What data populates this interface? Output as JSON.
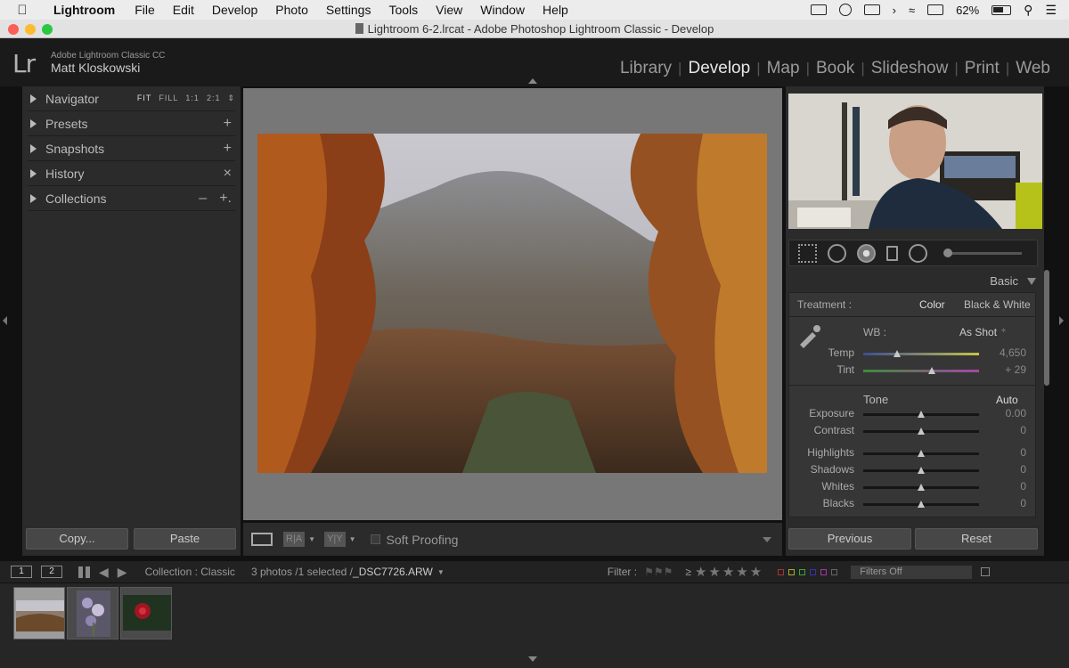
{
  "menubar": {
    "apple": "",
    "app_name": "Lightroom",
    "items": [
      "File",
      "Edit",
      "Develop",
      "Photo",
      "Settings",
      "Tools",
      "View",
      "Window",
      "Help"
    ],
    "battery": "62%"
  },
  "window": {
    "title": "Lightroom 6-2.lrcat - Adobe Photoshop Lightroom Classic - Develop"
  },
  "identity": {
    "logo": "Lr",
    "product": "Adobe Lightroom Classic CC",
    "user": "Matt Kloskowski"
  },
  "modules": [
    "Library",
    "Develop",
    "Map",
    "Book",
    "Slideshow",
    "Print",
    "Web"
  ],
  "active_module": "Develop",
  "left_panel": {
    "navigator": {
      "label": "Navigator",
      "zoom": [
        "FIT",
        "FILL",
        "1:1",
        "2:1"
      ]
    },
    "presets": {
      "label": "Presets",
      "action": "+"
    },
    "snapshots": {
      "label": "Snapshots",
      "action": "+"
    },
    "history": {
      "label": "History",
      "action": "×"
    },
    "collections": {
      "label": "Collections",
      "action_minus": "–",
      "action_plus": "+."
    },
    "copy_button": "Copy...",
    "paste_button": "Paste"
  },
  "toolbar": {
    "ra": "R|A",
    "yy": "Y|Y",
    "soft_proofing": "Soft Proofing"
  },
  "right_panel": {
    "panel_title": "Basic",
    "treatment_label": "Treatment :",
    "treatment_color": "Color",
    "treatment_bw": "Black & White",
    "wb_label": "WB :",
    "wb_value": "As Shot",
    "wb_caret": "÷",
    "tone_label": "Tone",
    "auto_button": "Auto",
    "sliders": [
      {
        "label": "Temp",
        "value": "4,650",
        "pos": 0.29
      },
      {
        "label": "Tint",
        "value": "+ 29",
        "pos": 0.59
      },
      {
        "label": "Exposure",
        "value": "0.00",
        "pos": 0.5
      },
      {
        "label": "Contrast",
        "value": "0",
        "pos": 0.5
      },
      {
        "label": "Highlights",
        "value": "0",
        "pos": 0.5
      },
      {
        "label": "Shadows",
        "value": "0",
        "pos": 0.5
      },
      {
        "label": "Whites",
        "value": "0",
        "pos": 0.5
      },
      {
        "label": "Blacks",
        "value": "0",
        "pos": 0.5
      }
    ],
    "previous_button": "Previous",
    "reset_button": "Reset"
  },
  "filmstrip_bar": {
    "view1": "1",
    "view2": "2",
    "collection": "Collection : Classic",
    "selection": "3 photos /1 selected /",
    "filename": "_DSC7726.ARW",
    "filter_label": "Filter :",
    "stars_prefix": "≥",
    "stars": "★★★★★",
    "filters_off": "Filters Off"
  },
  "filmstrip": {
    "selected_index": 0,
    "thumbnails": [
      "landscape-fog",
      "purple-flowers",
      "red-rose"
    ]
  },
  "colors": {
    "panel_bg": "#2b2b2b",
    "center_bg": "#777777",
    "active_module": "#e8e8e8"
  }
}
